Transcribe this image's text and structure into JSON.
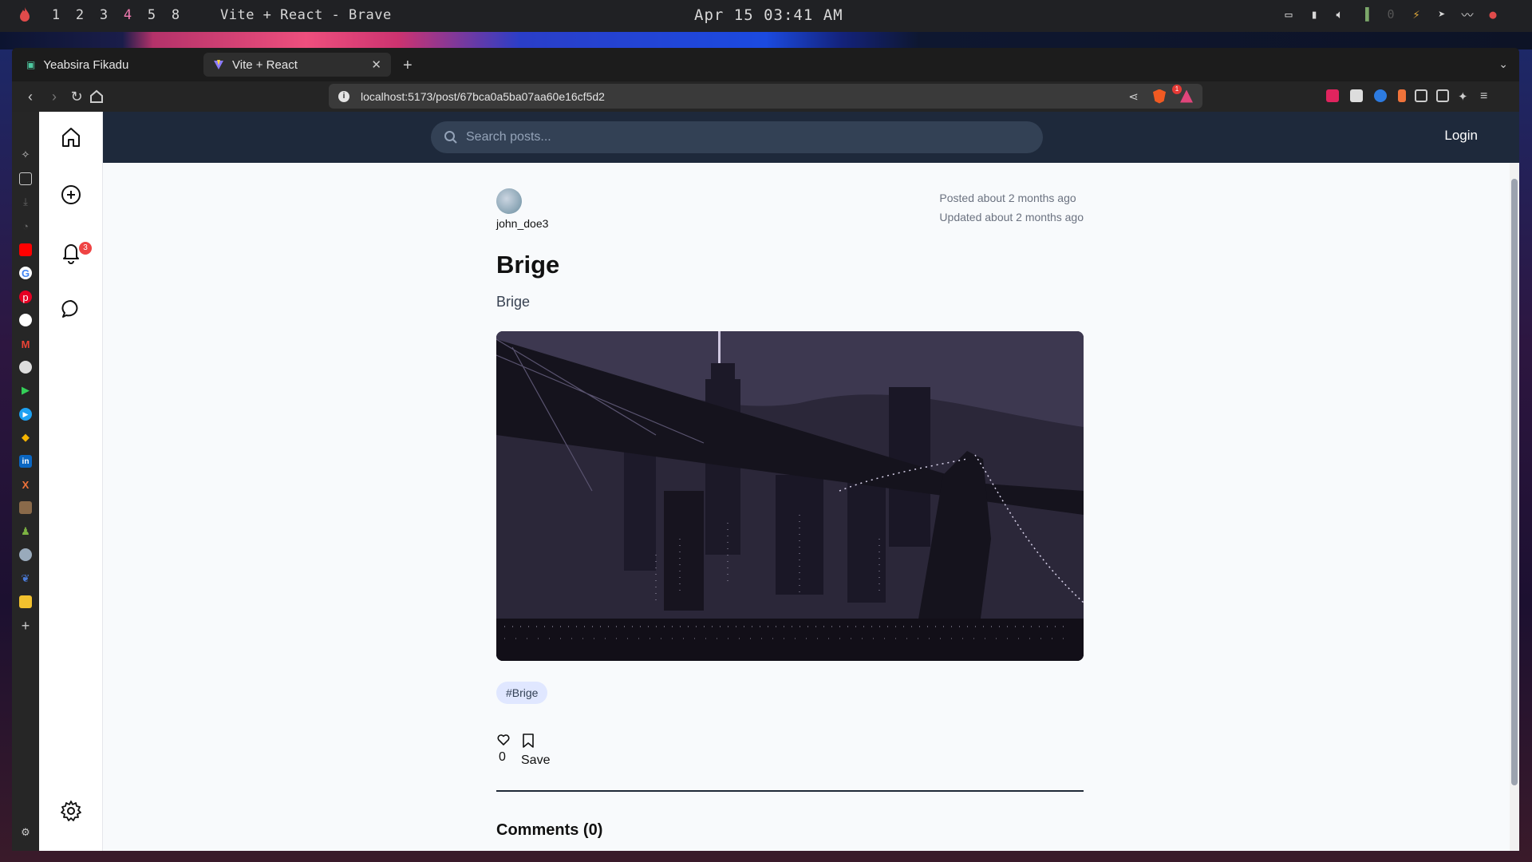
{
  "desktop": {
    "workspaces": [
      "1",
      "2",
      "3",
      "4",
      "5",
      "8"
    ],
    "window_title": "Vite + React - Brave",
    "clock": "Apr 15 03:41 AM"
  },
  "browser": {
    "tabs": [
      {
        "label": "Yeabsira Fikadu",
        "active": false
      },
      {
        "label": "Vite + React",
        "active": true
      }
    ],
    "url": "localhost:5173/post/67bca0a5ba07aa60e16cf5d2",
    "rewards_badge": "1"
  },
  "app": {
    "search_placeholder": "Search posts...",
    "login_label": "Login",
    "notification_count": "3"
  },
  "post": {
    "author": "john_doe3",
    "posted": "Posted about 2 months ago",
    "updated": "Updated about 2 months ago",
    "title": "Brige",
    "body": "Brige",
    "tag": "#Brige",
    "likes": "0",
    "save_label": "Save",
    "comments_heading": "Comments (0)"
  },
  "colors": {
    "header_bg": "#1e293b",
    "page_bg": "#f8fafc",
    "tag_bg": "#e0e7ff",
    "badge_red": "#ef4444"
  }
}
